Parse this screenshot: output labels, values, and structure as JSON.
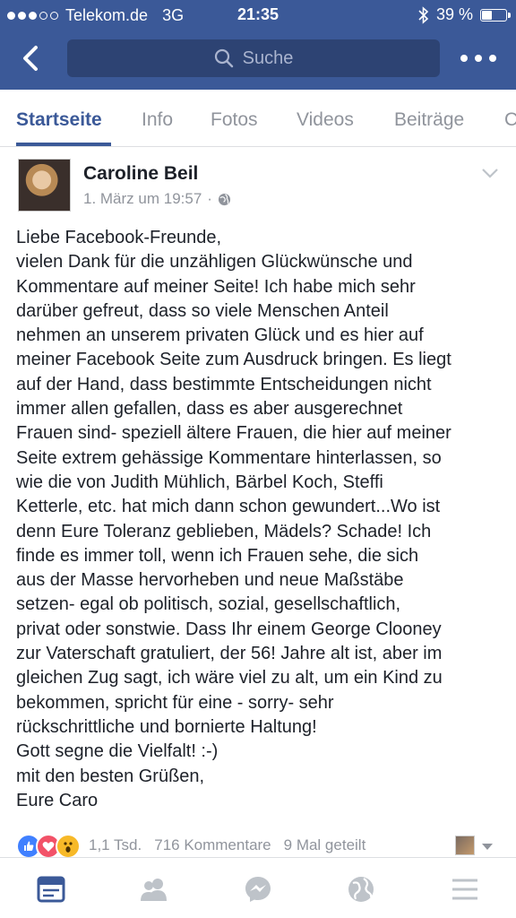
{
  "status_bar": {
    "carrier": "Telekom.de",
    "network": "3G",
    "time": "21:35",
    "battery": "39 %",
    "battery_level": 0.39
  },
  "nav": {
    "search_placeholder": "Suche"
  },
  "tabs": [
    {
      "label": "Startseite",
      "active": true
    },
    {
      "label": "Info"
    },
    {
      "label": "Fotos"
    },
    {
      "label": "Videos"
    },
    {
      "label": "Beiträge"
    },
    {
      "label": "C"
    }
  ],
  "post": {
    "author": "Caroline Beil",
    "date": "1. März um 19:57",
    "separator": "·",
    "text": "Liebe Facebook-Freunde,\nvielen Dank für die unzähligen Glückwünsche und\nKommentare auf meiner Seite! Ich habe mich sehr\ndarüber gefreut, dass so viele Menschen Anteil\nnehmen an unserem privaten Glück und es hier auf\nmeiner Facebook Seite zum Ausdruck bringen. Es liegt\nauf der Hand, dass bestimmte Entscheidungen nicht\nimmer allen gefallen, dass es aber ausgerechnet\nFrauen sind- speziell ältere Frauen, die hier auf meiner\nSeite extrem gehässige Kommentare hinterlassen, so\nwie die von Judith Mühlich, Bärbel Koch, Steffi\nKetterle, etc. hat mich dann schon gewundert...Wo ist\ndenn Eure Toleranz geblieben, Mädels? Schade! Ich\nfinde es immer toll, wenn ich Frauen sehe, die sich\naus der Masse hervorheben und neue Maßstäbe\nsetzen- egal ob politisch, sozial, gesellschaftlich,\nprivat oder sonstwie. Dass Ihr einem George Clooney\nzur Vaterschaft gratuliert, der 56! Jahre alt ist, aber im\ngleichen Zug sagt, ich wäre viel zu alt, um ein Kind zu\nbekommen, spricht für eine - sorry- sehr\nrückschrittliche und bornierte Haltung!\nGott segne die Vielfalt! :-)\nmit den besten Grüßen,\nEure Caro",
    "reactions_count": "1,1 Tsd.",
    "comments": "716 Kommentare",
    "shares": "9 Mal geteilt"
  },
  "colors": {
    "brand": "#3b5998",
    "like": "#4080ff",
    "love": "#f25268",
    "wow": "#f7b928"
  }
}
